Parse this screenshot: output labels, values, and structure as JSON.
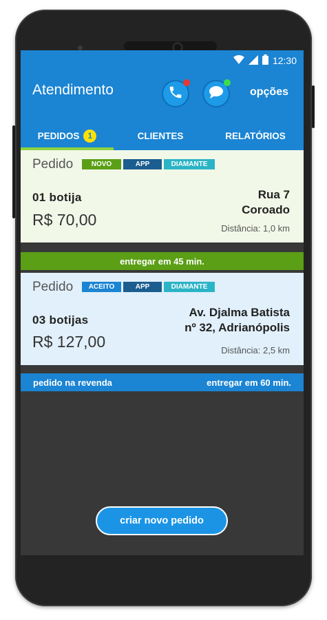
{
  "status_bar": {
    "time": "12:30",
    "icons": [
      "wifi-icon",
      "signal-icon",
      "battery-icon"
    ]
  },
  "header": {
    "title": "Atendimento",
    "phone_icon": "phone-icon",
    "chat_icon": "chat-icon",
    "options_label": "opções"
  },
  "tabs": [
    {
      "label": "PEDIDOS",
      "badge": "1",
      "active": true
    },
    {
      "label": "CLIENTES",
      "active": false
    },
    {
      "label": "RELATÓRIOS",
      "active": false
    }
  ],
  "orders": [
    {
      "label": "Pedido",
      "tags": [
        {
          "text": "NOVO",
          "color": "#5b9f16"
        },
        {
          "text": "APP",
          "color": "#1b5d8f"
        },
        {
          "text": "DIAMANTE",
          "color": "#2bb3c6"
        }
      ],
      "quantity": "01  botija",
      "price": "R$ 70,00",
      "address_line1": "Rua 7",
      "address_line2": "Coroado",
      "distance": "Distância: 1,0 km",
      "footer_left": "",
      "footer_right": "entregar em 45 min.",
      "background": "#f2f8e8",
      "footer_color": "#5b9f16"
    },
    {
      "label": "Pedido",
      "tags": [
        {
          "text": "ACEITO",
          "color": "#1b84d3"
        },
        {
          "text": "APP",
          "color": "#1b5d8f"
        },
        {
          "text": "DIAMANTE",
          "color": "#2bb3c6"
        }
      ],
      "quantity": "03  botijas",
      "price": "R$ 127,00",
      "address_line1": "Av. Djalma Batista",
      "address_line2": "nº 32, Adrianópolis",
      "distance": "Distância: 2,5 km",
      "footer_left": "pedido na revenda",
      "footer_right": "entregar em 60 min.",
      "background": "#e1f0fb",
      "footer_color": "#1b84d3"
    }
  ],
  "actions": {
    "new_order_label": "criar novo pedido"
  },
  "colors": {
    "primary": "#1b84d3",
    "accent_green": "#8dd23f",
    "badge_yellow": "#ffe100",
    "missed_call_dot": "#e53935",
    "online_dot": "#3ddc4b"
  }
}
